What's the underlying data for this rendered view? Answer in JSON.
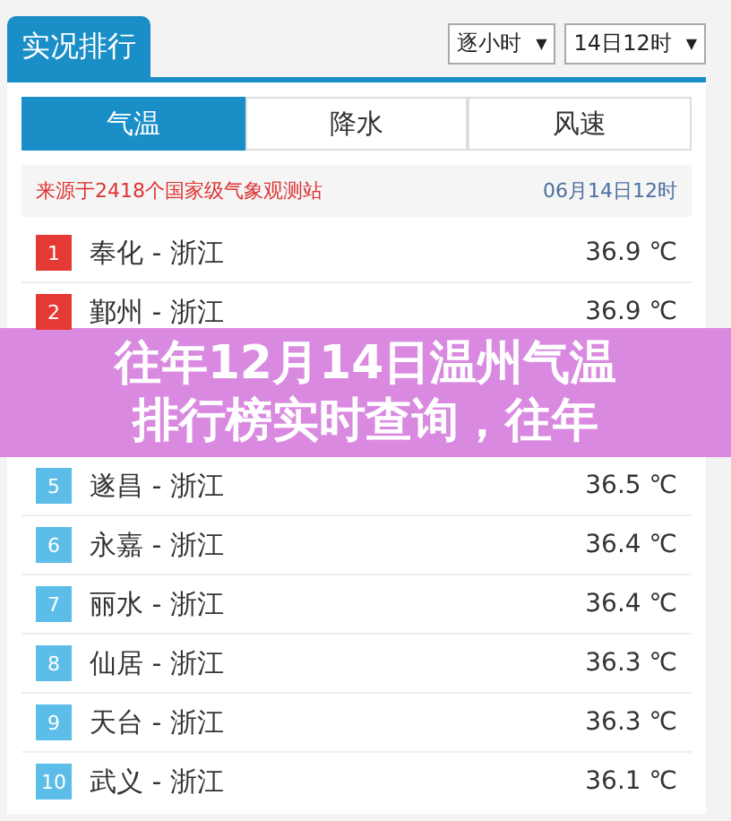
{
  "header": {
    "title": "实况排行",
    "selects": [
      {
        "value": "逐小时",
        "caret": "▼"
      },
      {
        "value": "14日12时",
        "caret": "▼"
      }
    ]
  },
  "tabs": [
    {
      "label": "气温",
      "selected": true
    },
    {
      "label": "降水",
      "selected": false
    },
    {
      "label": "风速",
      "selected": false
    }
  ],
  "source": {
    "text": "来源于2418个国家级气象观测站",
    "time": "06月14日12时"
  },
  "rows": [
    {
      "rank": "1",
      "color": "#e53935",
      "city": "奉化 - 浙江",
      "temp": "36.9 ℃"
    },
    {
      "rank": "2",
      "color": "#e53935",
      "city": "鄞州 - 浙江",
      "temp": "36.9 ℃"
    },
    {
      "rank": "5",
      "color": "#5bbde8",
      "city": "遂昌 - 浙江",
      "temp": "36.5 ℃"
    },
    {
      "rank": "6",
      "color": "#5bbde8",
      "city": "永嘉 - 浙江",
      "temp": "36.4 ℃"
    },
    {
      "rank": "7",
      "color": "#5bbde8",
      "city": "丽水 - 浙江",
      "temp": "36.4 ℃"
    },
    {
      "rank": "8",
      "color": "#5bbde8",
      "city": "仙居 - 浙江",
      "temp": "36.3 ℃"
    },
    {
      "rank": "9",
      "color": "#5bbde8",
      "city": "天台 - 浙江",
      "temp": "36.3 ℃"
    },
    {
      "rank": "10",
      "color": "#5bbde8",
      "city": "武义 - 浙江",
      "temp": "36.1 ℃"
    }
  ],
  "banner": {
    "lines": [
      "往年12月14日温州气温",
      "排行榜实时查询，往年"
    ]
  }
}
